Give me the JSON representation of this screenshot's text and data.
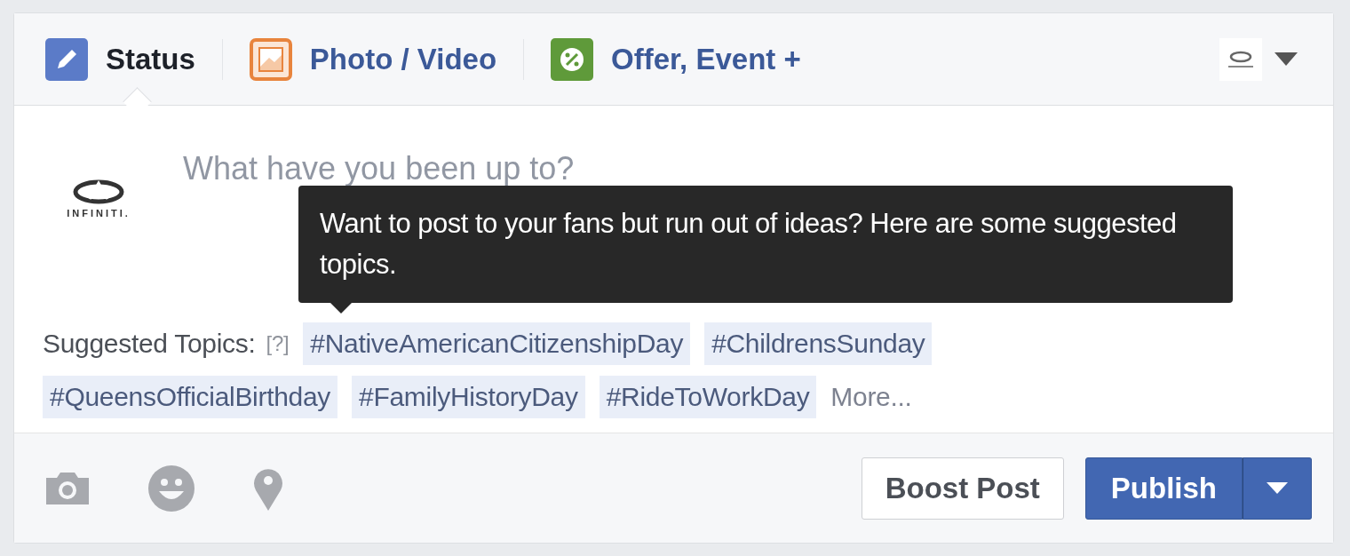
{
  "tabs": [
    {
      "label": "Status",
      "selected": true,
      "kind": "status"
    },
    {
      "label": "Photo / Video",
      "selected": false,
      "kind": "photo"
    },
    {
      "label": "Offer, Event +",
      "selected": false,
      "kind": "offer"
    }
  ],
  "composer": {
    "logo_text": "INFINITI.",
    "placeholder": "What have you been up to?"
  },
  "tooltip": {
    "text": "Want to post to your fans but run out of ideas? Here are some suggested topics."
  },
  "suggested_topics": {
    "label": "Suggested Topics:",
    "help": "[?]",
    "topics": [
      "#NativeAmericanCitizenshipDay",
      "#ChildrensSunday",
      "#QueensOfficialBirthday",
      "#FamilyHistoryDay",
      "#RideToWorkDay"
    ],
    "more": "More..."
  },
  "buttons": [
    {
      "label": "Boost Post",
      "kind": "secondary"
    },
    {
      "label": "Publish",
      "kind": "primary"
    }
  ]
}
